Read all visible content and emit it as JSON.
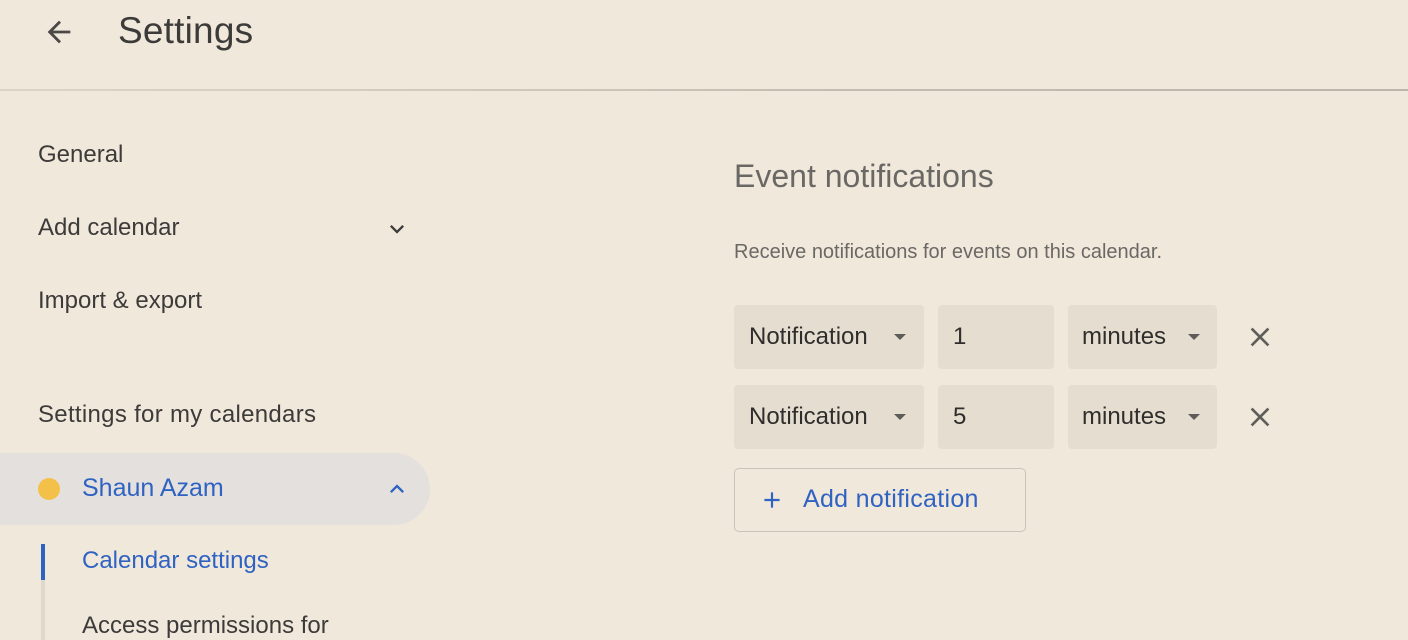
{
  "header": {
    "title": "Settings",
    "back_icon": "arrow-back-icon"
  },
  "sidebar": {
    "items": [
      {
        "label": "General"
      },
      {
        "label": "Add calendar",
        "icon": "chevron-down-icon"
      },
      {
        "label": "Import & export"
      }
    ],
    "section_heading": "Settings for my calendars",
    "calendar": {
      "name": "Shaun Azam",
      "dot_color": "#f3c04a",
      "icon": "chevron-up-icon",
      "expanded": true,
      "sub_items": [
        {
          "label": "Calendar settings",
          "active": true
        },
        {
          "label": "Access permissions for"
        }
      ]
    }
  },
  "main": {
    "title": "Event notifications",
    "description": "Receive notifications for events on this calendar.",
    "notifications": [
      {
        "type": "Notification",
        "amount": "1",
        "unit": "minutes"
      },
      {
        "type": "Notification",
        "amount": "5",
        "unit": "minutes"
      }
    ],
    "add_button": {
      "label": "Add notification",
      "icon": "plus-icon"
    }
  },
  "colors": {
    "background": "#f1e8dc",
    "accent": "#2f63c2",
    "field_background": "#e5ddd0",
    "selected_row": "#e4e0dd"
  }
}
